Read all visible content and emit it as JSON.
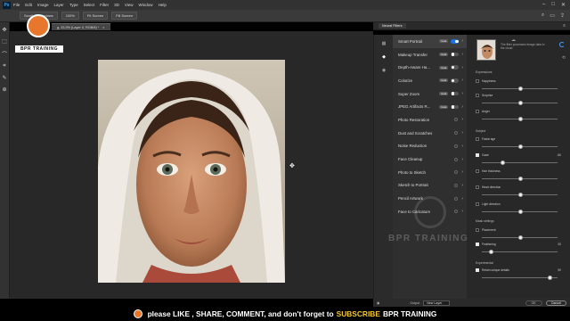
{
  "menubar": {
    "items": [
      "File",
      "Edit",
      "Image",
      "Layer",
      "Type",
      "Select",
      "Filter",
      "3D",
      "View",
      "Window",
      "Help"
    ]
  },
  "options": {
    "buttons": [
      "Scroll All Windows",
      "100%",
      "Fit Screen",
      "Fill Screen"
    ]
  },
  "document": {
    "tab_label": "g, 33.3% (Layer 0, RGB/8) *"
  },
  "panel": {
    "title": "Neural Filters",
    "filters": [
      {
        "name": "Smart Portrait",
        "beta": "beta",
        "toggle": "on",
        "selected": true
      },
      {
        "name": "Makeup Transfer",
        "beta": "beta",
        "toggle": "off"
      },
      {
        "name": "Depth-Aware Ha...",
        "beta": "beta",
        "toggle": "off"
      },
      {
        "name": "Colorize",
        "beta": "beta",
        "toggle": "off"
      },
      {
        "name": "Super Zoom",
        "beta": "beta",
        "toggle": "off"
      },
      {
        "name": "JPEG Artifacts R...",
        "beta": "beta",
        "toggle": "off"
      },
      {
        "name": "Photo Restoration",
        "beta": "",
        "toggle": "cloud"
      },
      {
        "name": "Dust and Scratches",
        "beta": "",
        "toggle": "cloud"
      },
      {
        "name": "Noise Reduction",
        "beta": "",
        "toggle": "cloud"
      },
      {
        "name": "Face Cleanup",
        "beta": "",
        "toggle": "cloud"
      },
      {
        "name": "Photo to Sketch",
        "beta": "",
        "toggle": "cloud"
      },
      {
        "name": "Sketch to Portrait",
        "beta": "",
        "toggle": "cloud"
      },
      {
        "name": "Pencil Artwork",
        "beta": "",
        "toggle": "cloud"
      },
      {
        "name": "Face to Caricature",
        "beta": "",
        "toggle": "cloud"
      }
    ],
    "preview_text": "The filter processes image data in the cloud",
    "sections": {
      "expressions": "Expressions",
      "subject": "Subject",
      "mask": "Mask settings",
      "experimental": "Experimental"
    },
    "sliders": [
      {
        "label": "Happiness",
        "checked": false,
        "value": "",
        "pos": 0.5
      },
      {
        "label": "Surprise",
        "checked": false,
        "value": "",
        "pos": 0.5
      },
      {
        "label": "Anger",
        "checked": false,
        "value": "",
        "pos": 0.5
      },
      {
        "label": "Facial age",
        "checked": false,
        "value": "",
        "pos": 0.5
      },
      {
        "label": "Gaze",
        "checked": true,
        "value": "-50",
        "pos": 0.25
      },
      {
        "label": "Hair thickness",
        "checked": false,
        "value": "",
        "pos": 0.5
      },
      {
        "label": "Head direction",
        "checked": false,
        "value": "",
        "pos": 0.5
      },
      {
        "label": "Light direction",
        "checked": false,
        "value": "",
        "pos": 0.5
      },
      {
        "label": "Placement",
        "checked": false,
        "value": "",
        "pos": 0.5
      },
      {
        "label": "Feathering",
        "checked": true,
        "value": "20",
        "pos": 0.1
      },
      {
        "label": "Retain unique details",
        "checked": true,
        "value": "90",
        "pos": 0.9
      }
    ],
    "footer": {
      "output_label": "Output",
      "output_value": "New Layer",
      "ok": "OK",
      "cancel": "Cancel"
    }
  },
  "overlay": {
    "logo_text": "BPR TRAINING",
    "watermark": "BPR TRAINING",
    "banner_main": "please LIKE , SHARE, COMMENT, and don't forget to",
    "banner_sub": "SUBSCRIBE",
    "banner_end": "BPR TRAINING"
  },
  "colors": {
    "accent": "#1a73e8",
    "logo": "#e8772e",
    "subscribe": "#f3c623"
  }
}
